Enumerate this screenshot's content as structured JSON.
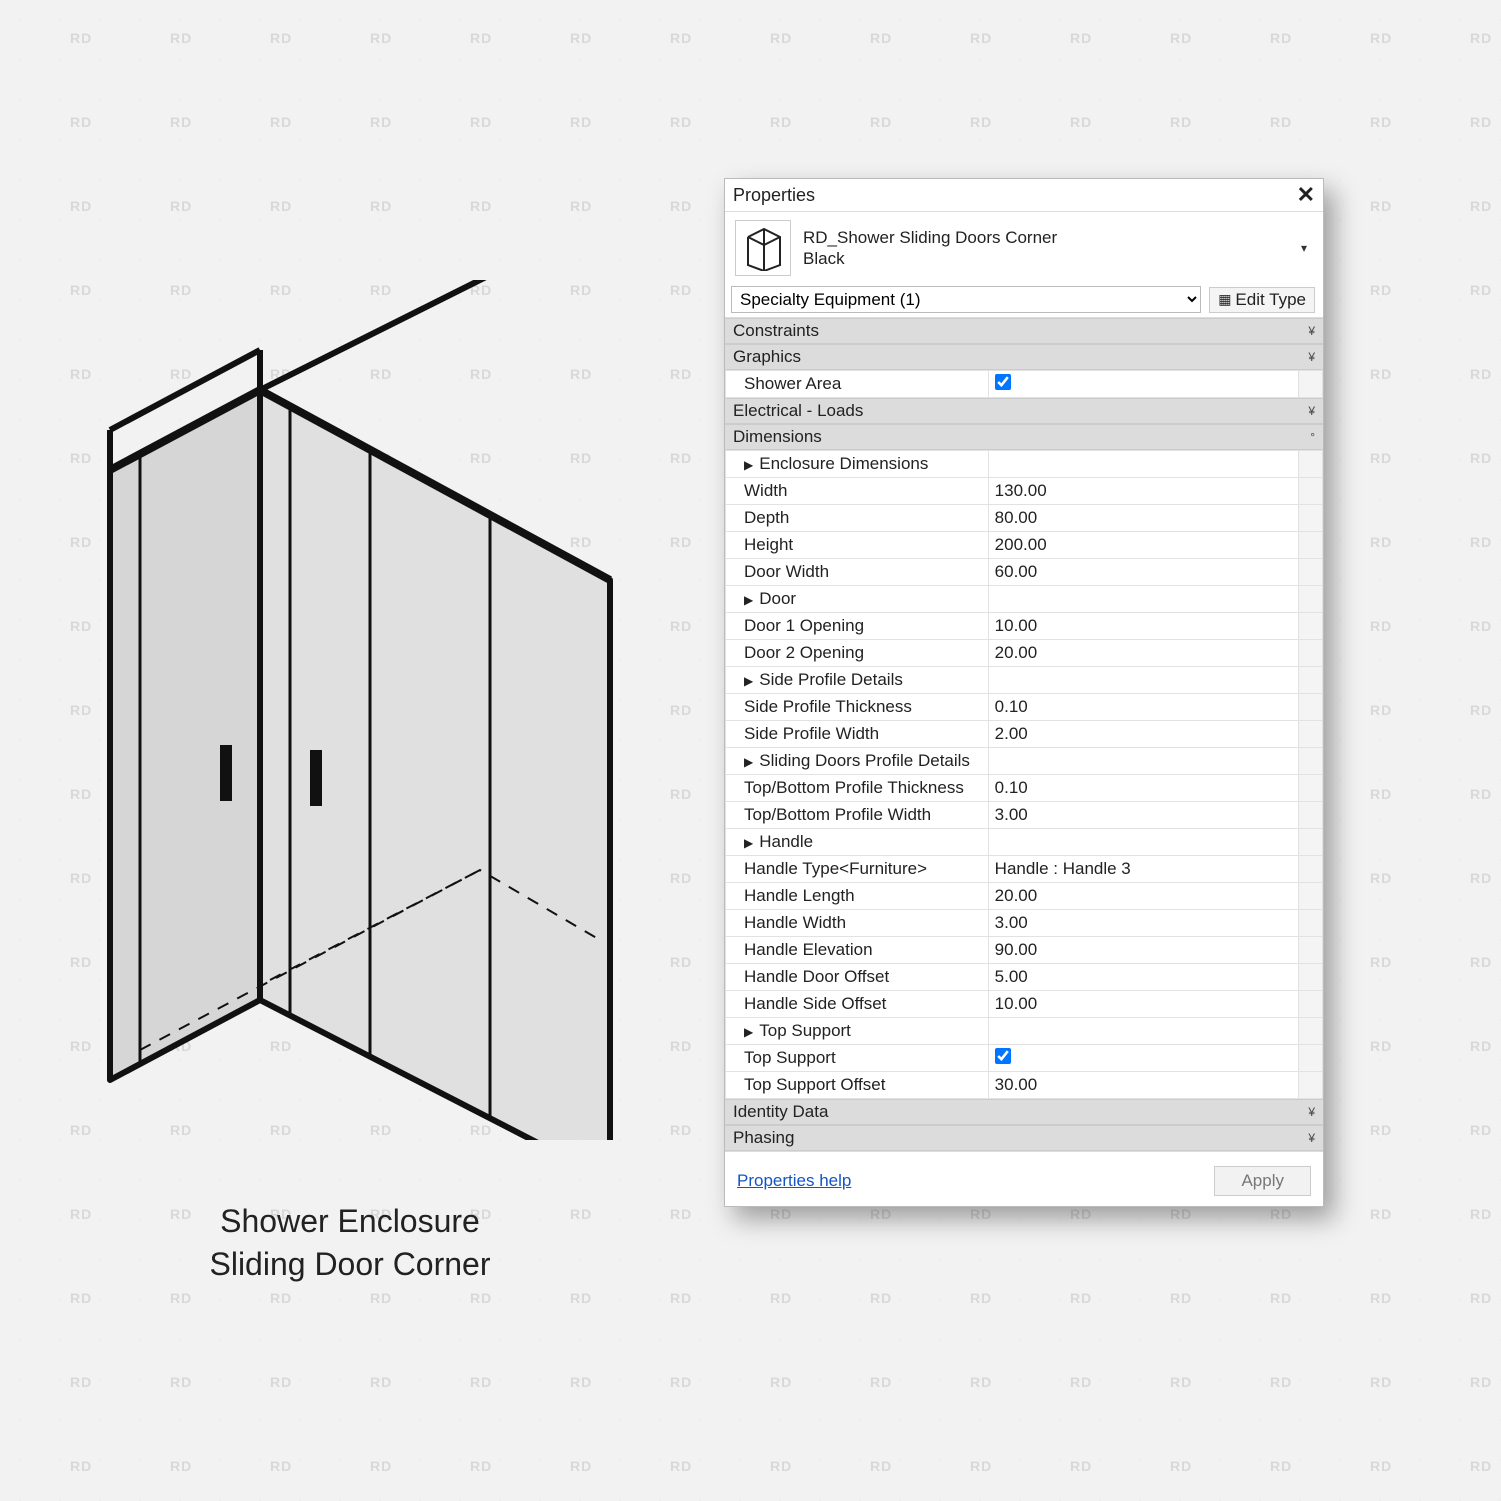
{
  "caption": {
    "line1": "Shower Enclosure",
    "line2": "Sliding Door Corner"
  },
  "panel": {
    "title": "Properties",
    "family_name": "RD_Shower Sliding Doors Corner",
    "family_type": "Black",
    "selector": "Specialty Equipment (1)",
    "edit_type": "Edit Type",
    "sections": {
      "constraints": "Constraints",
      "graphics": "Graphics",
      "electrical": "Electrical - Loads",
      "dimensions": "Dimensions",
      "identity": "Identity Data",
      "phasing": "Phasing"
    },
    "graphics_rows": [
      {
        "label": "Shower Area",
        "checkbox": true
      }
    ],
    "dim_rows": [
      {
        "label": "Enclosure Dimensions",
        "group": true
      },
      {
        "label": "Width",
        "value": "130.00"
      },
      {
        "label": "Depth",
        "value": "80.00"
      },
      {
        "label": "Height",
        "value": "200.00"
      },
      {
        "label": "Door Width",
        "value": "60.00"
      },
      {
        "label": "Door",
        "group": true
      },
      {
        "label": "Door 1 Opening",
        "value": "10.00"
      },
      {
        "label": "Door 2 Opening",
        "value": "20.00"
      },
      {
        "label": "Side Profile Details",
        "group": true
      },
      {
        "label": "Side Profile Thickness",
        "value": "0.10"
      },
      {
        "label": "Side Profile Width",
        "value": "2.00"
      },
      {
        "label": "Sliding Doors Profile Details",
        "group": true
      },
      {
        "label": "Top/Bottom Profile Thickness",
        "value": "0.10"
      },
      {
        "label": "Top/Bottom Profile Width",
        "value": "3.00"
      },
      {
        "label": "Handle",
        "group": true
      },
      {
        "label": "Handle Type<Furniture>",
        "value": "Handle : Handle 3"
      },
      {
        "label": "Handle Length",
        "value": "20.00"
      },
      {
        "label": "Handle Width",
        "value": "3.00"
      },
      {
        "label": "Handle Elevation",
        "value": "90.00"
      },
      {
        "label": "Handle Door Offset",
        "value": "5.00"
      },
      {
        "label": "Handle Side Offset",
        "value": "10.00"
      },
      {
        "label": "Top Support",
        "group": true
      },
      {
        "label": "Top Support",
        "checkbox": true
      },
      {
        "label": "Top Support Offset",
        "value": "30.00"
      }
    ],
    "help_link": "Properties help",
    "apply": "Apply"
  }
}
